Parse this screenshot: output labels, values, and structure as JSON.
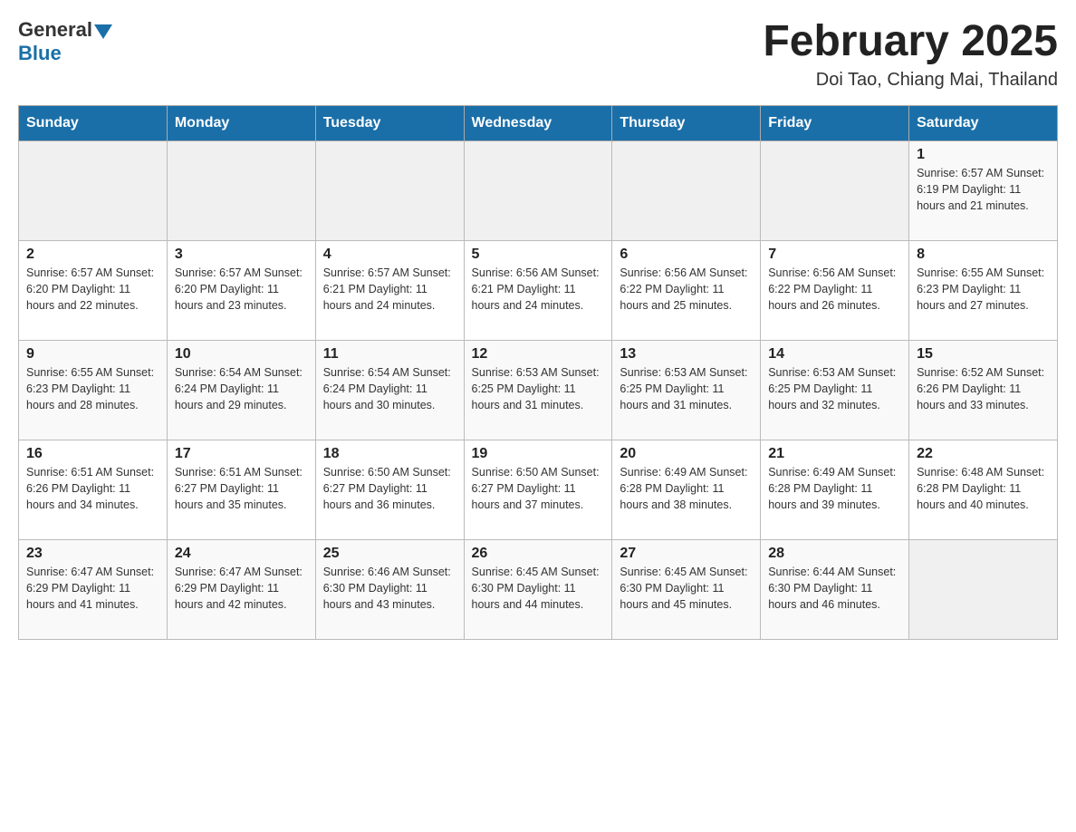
{
  "header": {
    "logo_general": "General",
    "logo_blue": "Blue",
    "title": "February 2025",
    "location": "Doi Tao, Chiang Mai, Thailand"
  },
  "days_of_week": [
    "Sunday",
    "Monday",
    "Tuesday",
    "Wednesday",
    "Thursday",
    "Friday",
    "Saturday"
  ],
  "weeks": [
    [
      {
        "day": "",
        "info": ""
      },
      {
        "day": "",
        "info": ""
      },
      {
        "day": "",
        "info": ""
      },
      {
        "day": "",
        "info": ""
      },
      {
        "day": "",
        "info": ""
      },
      {
        "day": "",
        "info": ""
      },
      {
        "day": "1",
        "info": "Sunrise: 6:57 AM\nSunset: 6:19 PM\nDaylight: 11 hours\nand 21 minutes."
      }
    ],
    [
      {
        "day": "2",
        "info": "Sunrise: 6:57 AM\nSunset: 6:20 PM\nDaylight: 11 hours\nand 22 minutes."
      },
      {
        "day": "3",
        "info": "Sunrise: 6:57 AM\nSunset: 6:20 PM\nDaylight: 11 hours\nand 23 minutes."
      },
      {
        "day": "4",
        "info": "Sunrise: 6:57 AM\nSunset: 6:21 PM\nDaylight: 11 hours\nand 24 minutes."
      },
      {
        "day": "5",
        "info": "Sunrise: 6:56 AM\nSunset: 6:21 PM\nDaylight: 11 hours\nand 24 minutes."
      },
      {
        "day": "6",
        "info": "Sunrise: 6:56 AM\nSunset: 6:22 PM\nDaylight: 11 hours\nand 25 minutes."
      },
      {
        "day": "7",
        "info": "Sunrise: 6:56 AM\nSunset: 6:22 PM\nDaylight: 11 hours\nand 26 minutes."
      },
      {
        "day": "8",
        "info": "Sunrise: 6:55 AM\nSunset: 6:23 PM\nDaylight: 11 hours\nand 27 minutes."
      }
    ],
    [
      {
        "day": "9",
        "info": "Sunrise: 6:55 AM\nSunset: 6:23 PM\nDaylight: 11 hours\nand 28 minutes."
      },
      {
        "day": "10",
        "info": "Sunrise: 6:54 AM\nSunset: 6:24 PM\nDaylight: 11 hours\nand 29 minutes."
      },
      {
        "day": "11",
        "info": "Sunrise: 6:54 AM\nSunset: 6:24 PM\nDaylight: 11 hours\nand 30 minutes."
      },
      {
        "day": "12",
        "info": "Sunrise: 6:53 AM\nSunset: 6:25 PM\nDaylight: 11 hours\nand 31 minutes."
      },
      {
        "day": "13",
        "info": "Sunrise: 6:53 AM\nSunset: 6:25 PM\nDaylight: 11 hours\nand 31 minutes."
      },
      {
        "day": "14",
        "info": "Sunrise: 6:53 AM\nSunset: 6:25 PM\nDaylight: 11 hours\nand 32 minutes."
      },
      {
        "day": "15",
        "info": "Sunrise: 6:52 AM\nSunset: 6:26 PM\nDaylight: 11 hours\nand 33 minutes."
      }
    ],
    [
      {
        "day": "16",
        "info": "Sunrise: 6:51 AM\nSunset: 6:26 PM\nDaylight: 11 hours\nand 34 minutes."
      },
      {
        "day": "17",
        "info": "Sunrise: 6:51 AM\nSunset: 6:27 PM\nDaylight: 11 hours\nand 35 minutes."
      },
      {
        "day": "18",
        "info": "Sunrise: 6:50 AM\nSunset: 6:27 PM\nDaylight: 11 hours\nand 36 minutes."
      },
      {
        "day": "19",
        "info": "Sunrise: 6:50 AM\nSunset: 6:27 PM\nDaylight: 11 hours\nand 37 minutes."
      },
      {
        "day": "20",
        "info": "Sunrise: 6:49 AM\nSunset: 6:28 PM\nDaylight: 11 hours\nand 38 minutes."
      },
      {
        "day": "21",
        "info": "Sunrise: 6:49 AM\nSunset: 6:28 PM\nDaylight: 11 hours\nand 39 minutes."
      },
      {
        "day": "22",
        "info": "Sunrise: 6:48 AM\nSunset: 6:28 PM\nDaylight: 11 hours\nand 40 minutes."
      }
    ],
    [
      {
        "day": "23",
        "info": "Sunrise: 6:47 AM\nSunset: 6:29 PM\nDaylight: 11 hours\nand 41 minutes."
      },
      {
        "day": "24",
        "info": "Sunrise: 6:47 AM\nSunset: 6:29 PM\nDaylight: 11 hours\nand 42 minutes."
      },
      {
        "day": "25",
        "info": "Sunrise: 6:46 AM\nSunset: 6:30 PM\nDaylight: 11 hours\nand 43 minutes."
      },
      {
        "day": "26",
        "info": "Sunrise: 6:45 AM\nSunset: 6:30 PM\nDaylight: 11 hours\nand 44 minutes."
      },
      {
        "day": "27",
        "info": "Sunrise: 6:45 AM\nSunset: 6:30 PM\nDaylight: 11 hours\nand 45 minutes."
      },
      {
        "day": "28",
        "info": "Sunrise: 6:44 AM\nSunset: 6:30 PM\nDaylight: 11 hours\nand 46 minutes."
      },
      {
        "day": "",
        "info": ""
      }
    ]
  ]
}
